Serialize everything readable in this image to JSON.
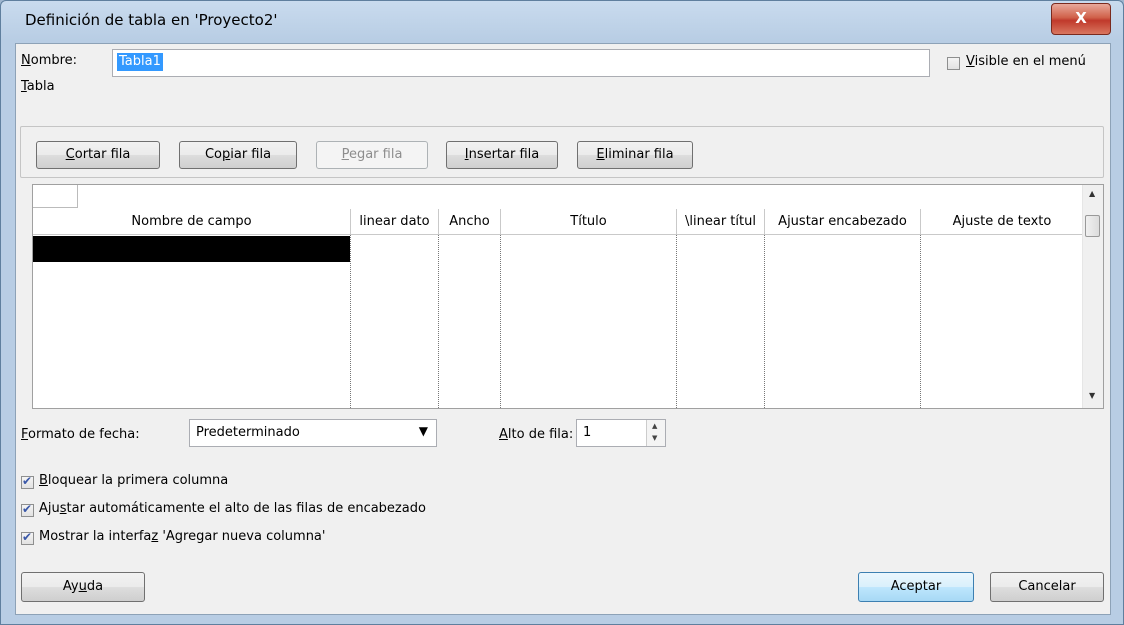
{
  "window": {
    "title": "Definición de tabla en 'Proyecto2'",
    "close_glyph": "X"
  },
  "name": {
    "label_first": "N",
    "label_rest": "ombre:",
    "value": "Tabla1"
  },
  "visible_menu": {
    "label_first": "V",
    "label_rest": "isible en el menú",
    "checked": false
  },
  "table_group": {
    "label_first": "T",
    "label_rest": "abla"
  },
  "toolbar": {
    "cut": {
      "pre": "",
      "ul": "C",
      "post": "ortar fila"
    },
    "copy": {
      "pre": "Co",
      "ul": "p",
      "post": "iar fila"
    },
    "paste": {
      "pre": "",
      "ul": "P",
      "post": "egar fila"
    },
    "insert": {
      "pre": "",
      "ul": "I",
      "post": "nsertar fila"
    },
    "delete": {
      "pre": "",
      "ul": "E",
      "post": "liminar fila"
    }
  },
  "grid": {
    "columns": [
      "Nombre de campo",
      "linear dato",
      "Ancho",
      "Título",
      "\\linear títul",
      "Ajustar encabezado",
      "Ajuste de texto"
    ]
  },
  "date_format": {
    "label_first": "F",
    "label_rest": "ormato de fecha:",
    "value": "Predeterminado"
  },
  "row_height": {
    "label_first": "A",
    "label_rest": "lto de fila:",
    "value": "1"
  },
  "options": [
    {
      "pre": "",
      "ul": "B",
      "post": "loquear la primera columna",
      "checked": true
    },
    {
      "pre": "Aju",
      "ul": "s",
      "post": "tar automáticamente el alto de las filas de encabezado",
      "checked": true
    },
    {
      "pre": "Mostrar la interfa",
      "ul": "z",
      "post": " 'Agregar nueva columna'",
      "checked": true
    }
  ],
  "footer": {
    "help": {
      "pre": "Ay",
      "ul": "u",
      "post": "da"
    },
    "ok": "Aceptar",
    "cancel": "Cancelar"
  },
  "icons": {
    "dropdown": "triangle-down-icon",
    "spin": "spinner-arrows-icon",
    "scroll": "scroll-arrows-icon"
  }
}
